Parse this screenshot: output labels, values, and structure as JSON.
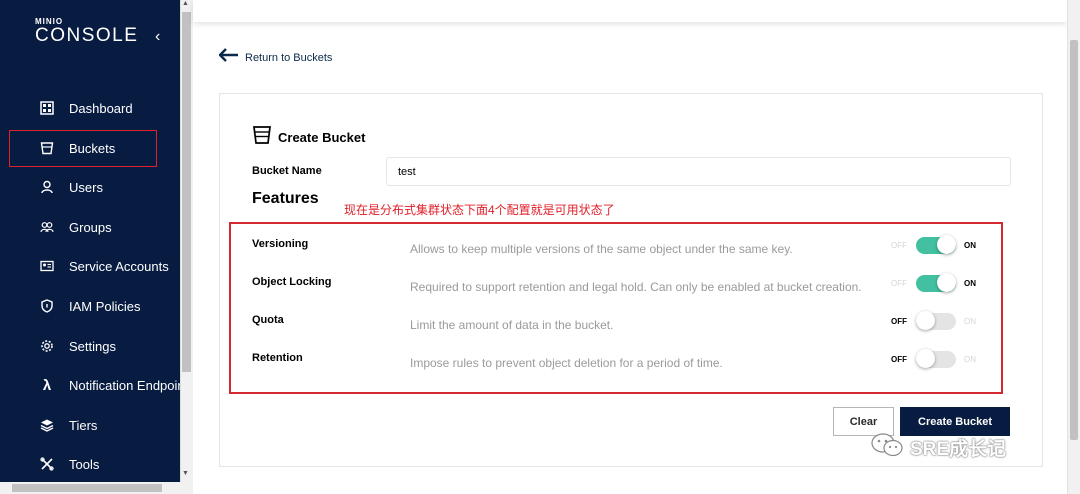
{
  "sidebar": {
    "logo_small": "MINIO",
    "logo_big": "CONSOLE",
    "collapse_icon": "chevron-left-icon",
    "items": [
      {
        "label": "Dashboard",
        "icon": "dashboard-icon"
      },
      {
        "label": "Buckets",
        "icon": "bucket-icon"
      },
      {
        "label": "Users",
        "icon": "user-icon"
      },
      {
        "label": "Groups",
        "icon": "groups-icon"
      },
      {
        "label": "Service Accounts",
        "icon": "id-card-icon"
      },
      {
        "label": "IAM Policies",
        "icon": "shield-icon"
      },
      {
        "label": "Settings",
        "icon": "gear-icon"
      },
      {
        "label": "Notification Endpoints",
        "icon": "lambda-icon"
      },
      {
        "label": "Tiers",
        "icon": "layers-icon"
      },
      {
        "label": "Tools",
        "icon": "tools-icon"
      }
    ]
  },
  "main": {
    "back_label": "Return to Buckets",
    "card_title": "Create Bucket",
    "bucket_name_label": "Bucket Name",
    "bucket_name_value": "test",
    "features_heading": "Features",
    "annotation": "现在是分布式集群状态下面4个配置就是可用状态了",
    "features": [
      {
        "name": "Versioning",
        "description": "Allows to keep multiple versions of the same object under the same key.",
        "state": "ON"
      },
      {
        "name": "Object Locking",
        "description": "Required to support retention and legal hold. Can only be enabled at bucket creation.",
        "state": "ON"
      },
      {
        "name": "Quota",
        "description": "Limit the amount of data in the bucket.",
        "state": "OFF"
      },
      {
        "name": "Retention",
        "description": "Impose rules to prevent object deletion for a period of time.",
        "state": "OFF"
      }
    ],
    "toggle_off_label": "OFF",
    "toggle_on_label": "ON",
    "clear_label": "Clear",
    "create_label": "Create Bucket"
  },
  "watermark": {
    "text": "SRE成长记",
    "icon": "wechat-icon"
  },
  "colors": {
    "sidebar_bg": "#081c42",
    "toggle_on": "#42c0a0",
    "highlight_red": "#e0202a"
  }
}
